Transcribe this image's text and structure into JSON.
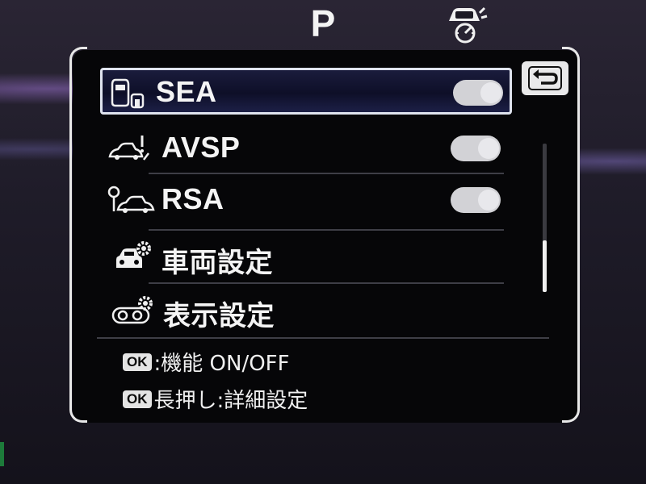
{
  "header": {
    "gear": "P",
    "status_icon": "car-speedometer-icon"
  },
  "back_button": {
    "icon": "return-arrow-icon"
  },
  "menu": {
    "items": [
      {
        "label": "SEA",
        "icon": "car-door-sensor-icon",
        "toggle": "on",
        "selected": true
      },
      {
        "label": "AVSP",
        "icon": "car-obstacle-alert-icon",
        "toggle": "on",
        "selected": false
      },
      {
        "label": "RSA",
        "icon": "car-road-sign-icon",
        "toggle": "on",
        "selected": false
      },
      {
        "label": "車両設定",
        "icon": "car-gear-icon",
        "selected": false
      },
      {
        "label": "表示設定",
        "icon": "display-gear-icon",
        "selected": false
      }
    ]
  },
  "help": {
    "badge": "OK",
    "line1": ":機能 ON/OFF",
    "line2": "長押し:詳細設定"
  },
  "scrollbar": {
    "position_fraction": 0.6
  },
  "colors": {
    "panel": "#060608",
    "selected_bg": "#1a1c3c",
    "frame": "#e8e8e8",
    "toggle": "#d2d2d6"
  }
}
